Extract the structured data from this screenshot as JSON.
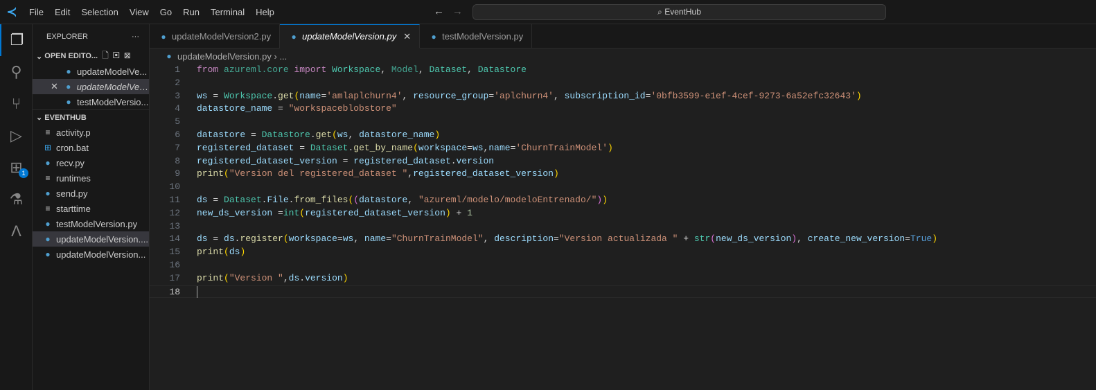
{
  "menu": [
    "File",
    "Edit",
    "Selection",
    "View",
    "Go",
    "Run",
    "Terminal",
    "Help"
  ],
  "search": "EventHub",
  "explorer": {
    "title": "EXPLORER",
    "more": "···",
    "open_editors": "OPEN EDITO...",
    "open_items": [
      "updateModelVe...",
      "updateModelVer...",
      "testModelVersio..."
    ],
    "folder": "EVENTHUB",
    "files": [
      {
        "name": "activity.p",
        "icon": "text"
      },
      {
        "name": "cron.bat",
        "icon": "windows"
      },
      {
        "name": "recv.py",
        "icon": "python"
      },
      {
        "name": "runtimes",
        "icon": "text"
      },
      {
        "name": "send.py",
        "icon": "python"
      },
      {
        "name": "starttime",
        "icon": "text"
      },
      {
        "name": "testModelVersion.py",
        "icon": "python"
      },
      {
        "name": "updateModelVersion....",
        "icon": "python"
      },
      {
        "name": "updateModelVersion...",
        "icon": "python"
      }
    ]
  },
  "activity_badge": "1",
  "tabs": [
    "updateModelVersion2.py",
    "updateModelVersion.py",
    "testModelVersion.py"
  ],
  "breadcrumb": {
    "file": "updateModelVersion.py",
    "rest": "..."
  },
  "code": [
    [
      [
        "from ",
        "k"
      ],
      [
        "azureml.core ",
        "m"
      ],
      [
        "import ",
        "k"
      ],
      [
        "Workspace",
        "c"
      ],
      [
        ", ",
        "p"
      ],
      [
        "Model",
        "m"
      ],
      [
        ", ",
        "p"
      ],
      [
        "Dataset",
        "c"
      ],
      [
        ", ",
        "p"
      ],
      [
        "Datastore",
        "c"
      ]
    ],
    [],
    [
      [
        "ws ",
        "v"
      ],
      [
        "= ",
        "p"
      ],
      [
        "Workspace",
        "c"
      ],
      [
        ".",
        "p"
      ],
      [
        "get",
        "f"
      ],
      [
        "(",
        "b"
      ],
      [
        "name",
        "v"
      ],
      [
        "=",
        "p"
      ],
      [
        "'amlaplchurn4'",
        "s"
      ],
      [
        ", ",
        "p"
      ],
      [
        "resource_group",
        "v"
      ],
      [
        "=",
        "p"
      ],
      [
        "'aplchurn4'",
        "s"
      ],
      [
        ", ",
        "p"
      ],
      [
        "subscription_id",
        "v"
      ],
      [
        "=",
        "p"
      ],
      [
        "'0bfb3599-e1ef-4cef-9273-6a52efc32643'",
        "s"
      ],
      [
        ")",
        "b"
      ]
    ],
    [
      [
        "datastore_name ",
        "v"
      ],
      [
        "= ",
        "p"
      ],
      [
        "\"workspaceblobstore\"",
        "s"
      ]
    ],
    [],
    [
      [
        "datastore ",
        "v"
      ],
      [
        "= ",
        "p"
      ],
      [
        "Datastore",
        "c"
      ],
      [
        ".",
        "p"
      ],
      [
        "get",
        "f"
      ],
      [
        "(",
        "b"
      ],
      [
        "ws",
        "v"
      ],
      [
        ", ",
        "p"
      ],
      [
        "datastore_name",
        "v"
      ],
      [
        ")",
        "b"
      ]
    ],
    [
      [
        "registered_dataset ",
        "v"
      ],
      [
        "= ",
        "p"
      ],
      [
        "Dataset",
        "c"
      ],
      [
        ".",
        "p"
      ],
      [
        "get_by_name",
        "f"
      ],
      [
        "(",
        "b"
      ],
      [
        "workspace",
        "v"
      ],
      [
        "=",
        "p"
      ],
      [
        "ws",
        "v"
      ],
      [
        ",",
        "p"
      ],
      [
        "name",
        "v"
      ],
      [
        "=",
        "p"
      ],
      [
        "'ChurnTrainModel'",
        "s"
      ],
      [
        ")",
        "b"
      ]
    ],
    [
      [
        "registered_dataset_version ",
        "v"
      ],
      [
        "= ",
        "p"
      ],
      [
        "registered_dataset",
        "v"
      ],
      [
        ".",
        "p"
      ],
      [
        "version",
        "v"
      ]
    ],
    [
      [
        "print",
        "f"
      ],
      [
        "(",
        "b"
      ],
      [
        "\"Version del registered_dataset \"",
        "s"
      ],
      [
        ",",
        "p"
      ],
      [
        "registered_dataset_version",
        "v"
      ],
      [
        ")",
        "b"
      ]
    ],
    [],
    [
      [
        "ds ",
        "v"
      ],
      [
        "= ",
        "p"
      ],
      [
        "Dataset",
        "c"
      ],
      [
        ".",
        "p"
      ],
      [
        "File",
        "v"
      ],
      [
        ".",
        "p"
      ],
      [
        "from_files",
        "f"
      ],
      [
        "(",
        "b"
      ],
      [
        "(",
        "b2"
      ],
      [
        "datastore",
        "v"
      ],
      [
        ", ",
        "p"
      ],
      [
        "\"azureml/modelo/modeloEntrenado/\"",
        "s"
      ],
      [
        ")",
        "b2"
      ],
      [
        ")",
        "b"
      ]
    ],
    [
      [
        "new_ds_version ",
        "v"
      ],
      [
        "=",
        "p"
      ],
      [
        "int",
        "c"
      ],
      [
        "(",
        "b"
      ],
      [
        "registered_dataset_version",
        "v"
      ],
      [
        ")",
        "b"
      ],
      [
        " + ",
        "p"
      ],
      [
        "1",
        "n"
      ]
    ],
    [],
    [
      [
        "ds ",
        "v"
      ],
      [
        "= ",
        "p"
      ],
      [
        "ds",
        "v"
      ],
      [
        ".",
        "p"
      ],
      [
        "register",
        "f"
      ],
      [
        "(",
        "b"
      ],
      [
        "workspace",
        "v"
      ],
      [
        "=",
        "p"
      ],
      [
        "ws",
        "v"
      ],
      [
        ", ",
        "p"
      ],
      [
        "name",
        "v"
      ],
      [
        "=",
        "p"
      ],
      [
        "\"ChurnTrainModel\"",
        "s"
      ],
      [
        ", ",
        "p"
      ],
      [
        "description",
        "v"
      ],
      [
        "=",
        "p"
      ],
      [
        "\"Version actualizada \"",
        "s"
      ],
      [
        " + ",
        "p"
      ],
      [
        "str",
        "c"
      ],
      [
        "(",
        "b2"
      ],
      [
        "new_ds_version",
        "v"
      ],
      [
        ")",
        "b2"
      ],
      [
        ", ",
        "p"
      ],
      [
        "create_new_version",
        "v"
      ],
      [
        "=",
        "p"
      ],
      [
        "True",
        "bl"
      ],
      [
        ")",
        "b"
      ]
    ],
    [
      [
        "print",
        "f"
      ],
      [
        "(",
        "b"
      ],
      [
        "ds",
        "v"
      ],
      [
        ")",
        "b"
      ]
    ],
    [],
    [
      [
        "print",
        "f"
      ],
      [
        "(",
        "b"
      ],
      [
        "\"Version \"",
        "s"
      ],
      [
        ",",
        "p"
      ],
      [
        "ds",
        "v"
      ],
      [
        ".",
        "p"
      ],
      [
        "version",
        "v"
      ],
      [
        ")",
        "b"
      ]
    ],
    []
  ],
  "current_line": 18
}
